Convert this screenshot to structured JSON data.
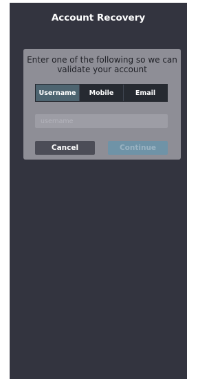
{
  "header": {
    "title": "Account Recovery"
  },
  "modal": {
    "prompt": "Enter one of the following so we can validate your account",
    "tabs": [
      {
        "label": "Username",
        "active": true
      },
      {
        "label": "Mobile",
        "active": false
      },
      {
        "label": "Email",
        "active": false
      }
    ],
    "input": {
      "placeholder": "username",
      "value": ""
    },
    "cancel_label": "Cancel",
    "continue_label": "Continue"
  }
}
